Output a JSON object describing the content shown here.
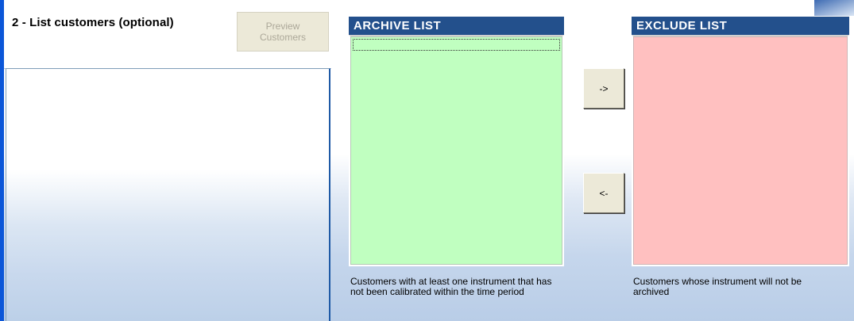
{
  "section": {
    "title": "2 - List customers (optional)",
    "preview_button": {
      "line1": "Preview",
      "line2": "Customers"
    }
  },
  "archive": {
    "header": "ARCHIVE LIST",
    "caption": "Customers with at least one instrument that has not been calibrated within the time period",
    "background_color": "#c0ffc0"
  },
  "exclude": {
    "header": "EXCLUDE LIST",
    "caption": "Customers whose instrument will not be archived",
    "background_color": "#ffc0c0"
  },
  "buttons": {
    "move_right": "->",
    "move_left": "<-"
  },
  "colors": {
    "header_bg": "#23508c",
    "accent_strip": "#0b56d8"
  }
}
